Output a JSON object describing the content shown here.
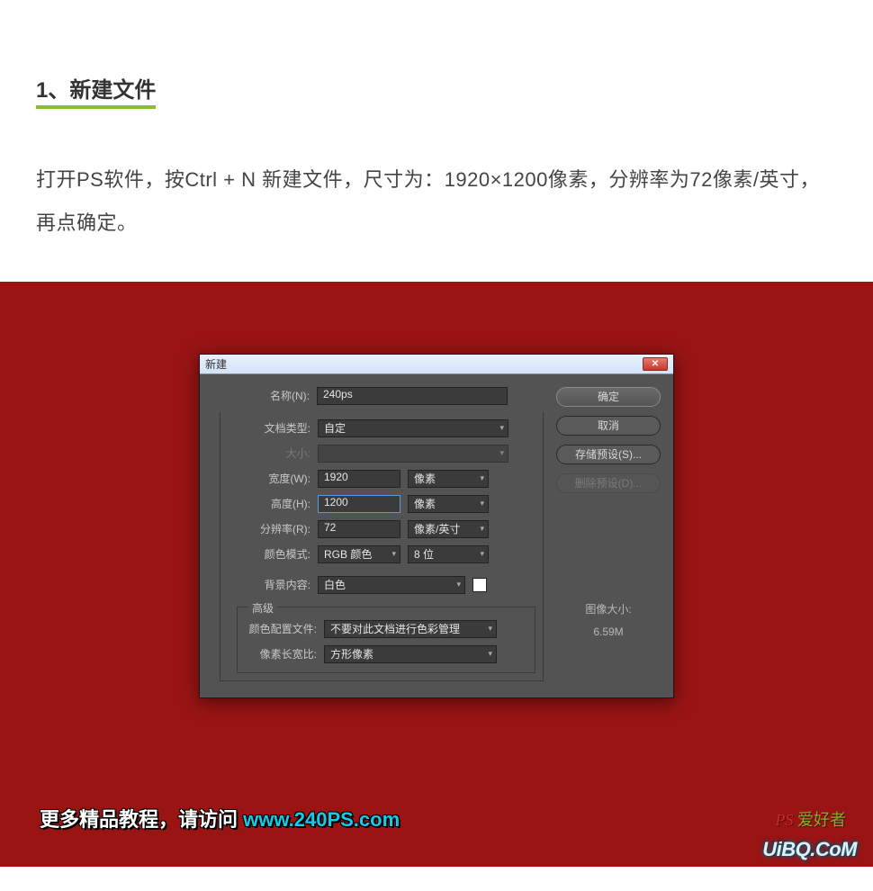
{
  "step": {
    "title": "1、新建文件",
    "description": "打开PS软件，按Ctrl + N 新建文件，尺寸为：1920×1200像素，分辨率为72像素/英寸，再点确定。"
  },
  "dialog": {
    "title": "新建",
    "labels": {
      "name": "名称(N):",
      "docType": "文档类型:",
      "size": "大小:",
      "width": "宽度(W):",
      "height": "高度(H):",
      "resolution": "分辨率(R):",
      "colorMode": "颜色模式:",
      "bgContent": "背景内容:",
      "advanced": "高级",
      "colorProfile": "颜色配置文件:",
      "pixelAspect": "像素长宽比:"
    },
    "values": {
      "name": "240ps",
      "docType": "自定",
      "width": "1920",
      "height": "1200",
      "resolution": "72",
      "colorMode": "RGB 颜色",
      "bitDepth": "8 位",
      "bgContent": "白色",
      "colorProfile": "不要对此文档进行色彩管理",
      "pixelAspect": "方形像素"
    },
    "units": {
      "pixel": "像素",
      "ppi": "像素/英寸"
    },
    "buttons": {
      "ok": "确定",
      "cancel": "取消",
      "savePreset": "存储预设(S)...",
      "deletePreset": "删除预设(D)..."
    },
    "imageSize": {
      "label": "图像大小:",
      "value": "6.59M"
    }
  },
  "footer": {
    "prefix": "更多精品教程，请访问 ",
    "link": "www.240PS.com"
  },
  "watermark1": {
    "p": "PS",
    "rest": " 爱好者"
  },
  "watermark2": "UiBQ.CoM"
}
